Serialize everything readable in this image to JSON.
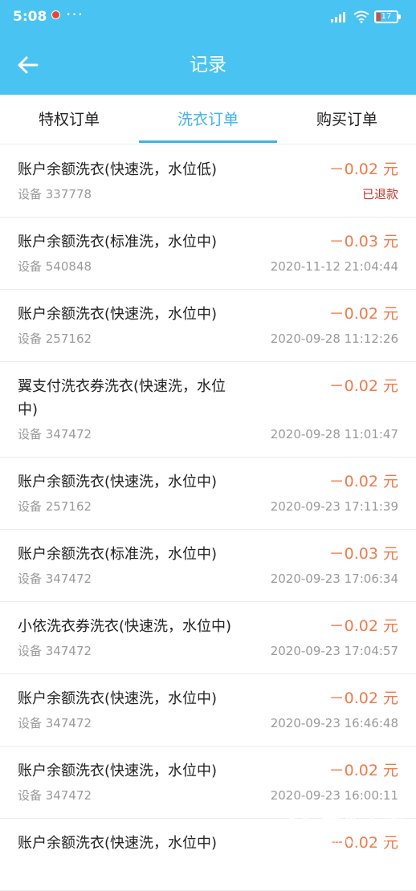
{
  "status_bar": {
    "time": "5:08",
    "more": "···",
    "battery": "17",
    "icons": [
      "notification-icon",
      "signal-icon",
      "wifi-icon",
      "battery-icon"
    ]
  },
  "navbar": {
    "title": "记录",
    "back_icon": "back-arrow-icon"
  },
  "colors": {
    "header": "#49c3f1",
    "active_tab": "#3fb2ea",
    "amount": "#f07a4b",
    "refund": "#c0392b"
  },
  "tabs": [
    {
      "label": "特权订单",
      "active": false
    },
    {
      "label": "洗衣订单",
      "active": true
    },
    {
      "label": "购买订单",
      "active": false
    }
  ],
  "orders": [
    {
      "title": "账户余额洗衣(快速洗，水位低)",
      "amount": "－0.02 元",
      "device": "设备 337778",
      "status": "已退款"
    },
    {
      "title": "账户余额洗衣(标准洗，水位中)",
      "amount": "－0.03 元",
      "device": "设备 540848",
      "status": "2020-11-12 21:04:44"
    },
    {
      "title": "账户余额洗衣(快速洗，水位中)",
      "amount": "－0.02 元",
      "device": "设备 257162",
      "status": "2020-09-28 11:12:26"
    },
    {
      "title": "翼支付洗衣券洗衣(快速洗，水位中)",
      "amount": "－0.02 元",
      "device": "设备 347472",
      "status": "2020-09-28 11:01:47"
    },
    {
      "title": "账户余额洗衣(快速洗，水位中)",
      "amount": "－0.02 元",
      "device": "设备 257162",
      "status": "2020-09-23 17:11:39"
    },
    {
      "title": "账户余额洗衣(标准洗，水位中)",
      "amount": "－0.03 元",
      "device": "设备 347472",
      "status": "2020-09-23 17:06:34"
    },
    {
      "title": "小依洗衣券洗衣(快速洗，水位中)",
      "amount": "－0.02 元",
      "device": "设备 347472",
      "status": "2020-09-23 17:04:57"
    },
    {
      "title": "账户余额洗衣(快速洗，水位中)",
      "amount": "－0.02 元",
      "device": "设备 347472",
      "status": "2020-09-23 16:46:48"
    },
    {
      "title": "账户余额洗衣(快速洗，水位中)",
      "amount": "－0.02 元",
      "device": "设备 347472",
      "status": "2020-09-23 16:00:11"
    },
    {
      "title": "账户余额洗衣(快速洗，水位中)",
      "amount": "－0.02 元",
      "device": "",
      "status": ""
    }
  ],
  "watermark": {
    "text": "硬件之家",
    "sub": "YING JIAN ZHI JIA"
  }
}
